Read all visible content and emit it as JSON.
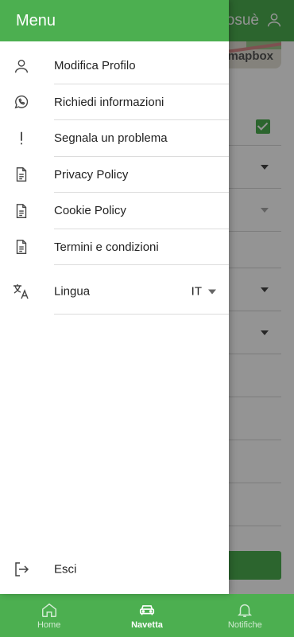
{
  "app": {
    "accent_color": "#4caf50"
  },
  "background": {
    "username_fragment": "osuè",
    "map_logo": "mapbox"
  },
  "drawer": {
    "title": "Menu",
    "items": [
      {
        "label": "Modifica Profilo",
        "icon": "user-icon"
      },
      {
        "label": "Richiedi informazioni",
        "icon": "whatsapp-icon"
      },
      {
        "label": "Segnala un problema",
        "icon": "exclamation-icon"
      },
      {
        "label": "Privacy Policy",
        "icon": "document-icon"
      },
      {
        "label": "Cookie Policy",
        "icon": "document-icon"
      },
      {
        "label": "Termini e condizioni",
        "icon": "document-icon"
      }
    ],
    "language": {
      "label": "Lingua",
      "value": "IT",
      "icon": "translate-icon"
    },
    "logout": {
      "label": "Esci",
      "icon": "logout-icon"
    }
  },
  "bottom_nav": {
    "items": [
      {
        "label": "Home",
        "icon": "home-icon",
        "active": false
      },
      {
        "label": "Navetta",
        "icon": "car-icon",
        "active": true
      },
      {
        "label": "Notifiche",
        "icon": "bell-icon",
        "active": false
      }
    ]
  }
}
